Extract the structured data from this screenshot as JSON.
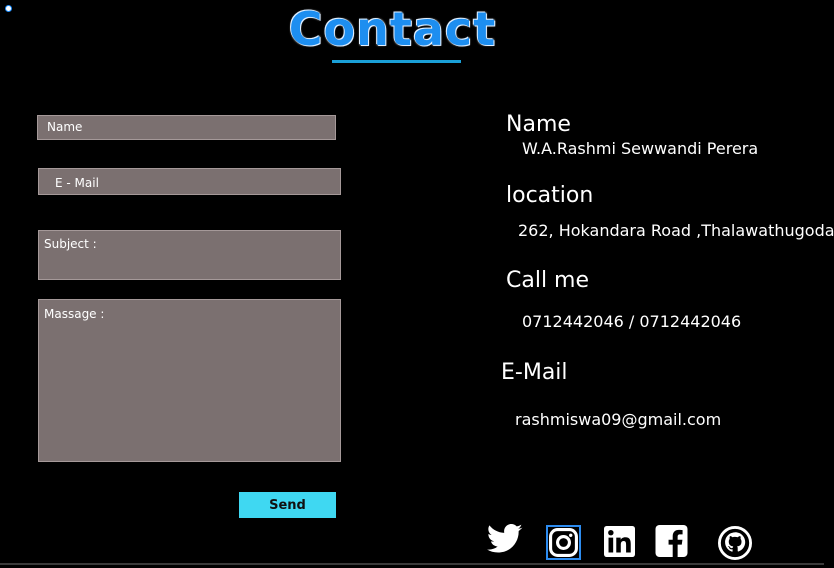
{
  "page": {
    "title": "Contact",
    "accent_color": "#1d8ef0"
  },
  "form": {
    "name_placeholder": "Name",
    "email_placeholder": "E - Mail",
    "subject_placeholder": "Subject :",
    "message_placeholder": "Massage :",
    "send_label": "Send",
    "send_color": "#3fd8f2"
  },
  "info": {
    "name_heading": "Name",
    "name_value": "W.A.Rashmi Sewwandi Perera",
    "location_heading": "location",
    "location_value": "262, Hokandara Road ,Thalawathugoda",
    "call_heading": "Call me",
    "call_value": "0712442046 / 0712442046",
    "email_heading": "E-Mail",
    "email_value": "rashmiswa09@gmail.com"
  },
  "social": {
    "icons": [
      "twitter-icon",
      "instagram-icon",
      "linkedin-icon",
      "facebook-icon",
      "github-icon"
    ]
  }
}
